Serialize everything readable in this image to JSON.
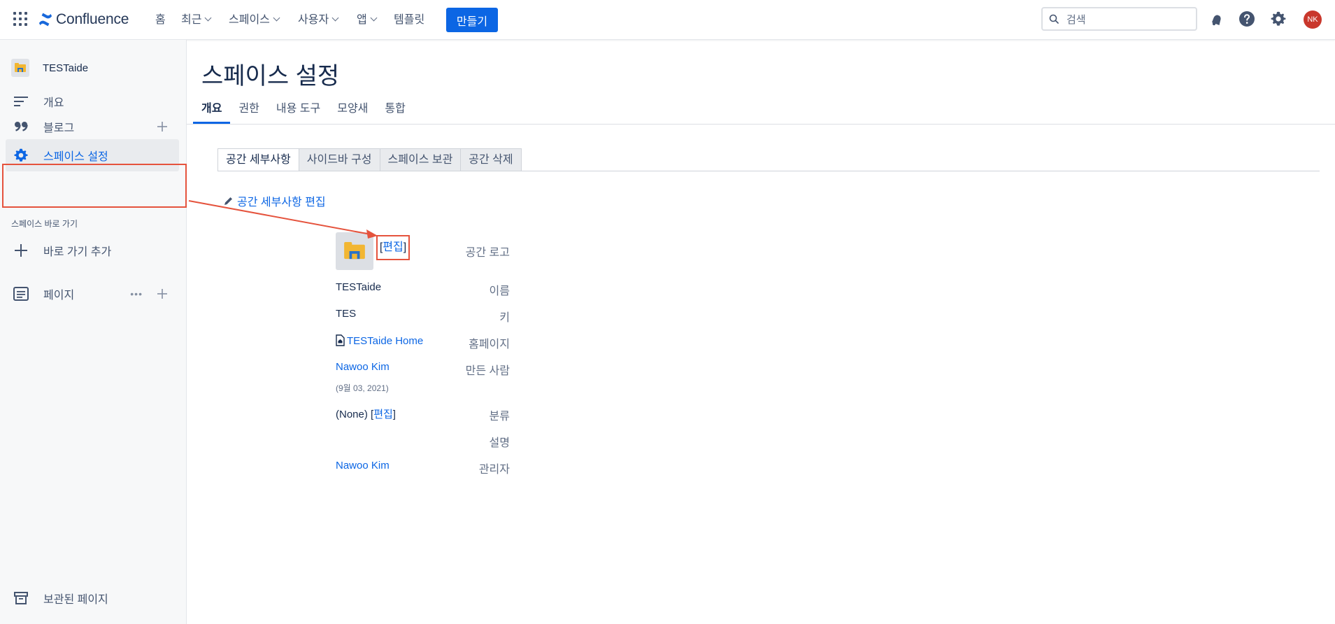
{
  "topnav": {
    "brand": "Confluence",
    "items": [
      {
        "label": "홈"
      },
      {
        "label": "최근"
      },
      {
        "label": "스페이스"
      },
      {
        "label": "사용자"
      },
      {
        "label": "앱"
      },
      {
        "label": "템플릿"
      }
    ],
    "create_label": "만들기",
    "search_placeholder": "검색",
    "avatar_initials": "NK"
  },
  "sidebar": {
    "space_name": "TESTaide",
    "items": [
      {
        "label": "개요"
      },
      {
        "label": "블로그"
      },
      {
        "label": "스페이스 설정"
      }
    ],
    "shortcuts_heading": "스페이스 바로 가기",
    "add_shortcut_label": "바로 가기 추가",
    "pages_label": "페이지",
    "archived_label": "보관된 페이지"
  },
  "main": {
    "title": "스페이스 설정",
    "tabs": [
      {
        "label": "개요"
      },
      {
        "label": "권한"
      },
      {
        "label": "내용 도구"
      },
      {
        "label": "모양새"
      },
      {
        "label": "통합"
      }
    ],
    "subtabs": [
      {
        "label": "공간 세부사항"
      },
      {
        "label": "사이드바 구성"
      },
      {
        "label": "스페이스 보관"
      },
      {
        "label": "공간 삭제"
      }
    ],
    "edit_details_label": "공간 세부사항 편집",
    "details": {
      "logo_label": "공간 로고",
      "logo_edit_open": "[",
      "logo_edit": "편집",
      "logo_edit_close": "]",
      "name_label": "이름",
      "name_value": "TESTaide",
      "key_label": "키",
      "key_value": "TES",
      "homepage_label": "홈페이지",
      "homepage_value": "TESTaide Home",
      "creator_label": "만든 사람",
      "creator_value": "Nawoo Kim",
      "created_date": "(9월 03, 2021)",
      "category_label": "분류",
      "category_value": "(None) [",
      "category_edit": "편집",
      "category_close": "]",
      "description_label": "설명",
      "admin_label": "관리자",
      "admin_value": "Nawoo Kim"
    }
  },
  "colors": {
    "accent": "#0c66e4",
    "annotation": "#e5533d",
    "avatar": "#c9372c"
  }
}
